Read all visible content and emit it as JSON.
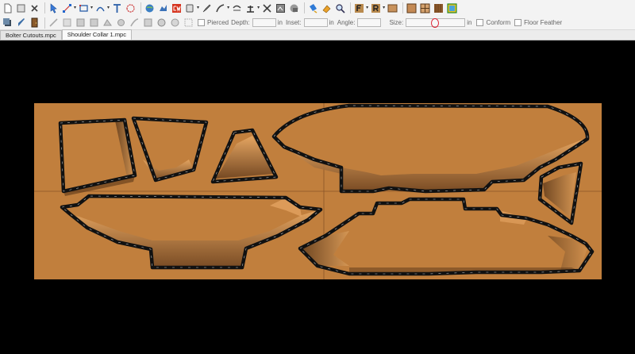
{
  "toolbar": {
    "buttons": [
      "new-file-icon",
      "open-file-icon",
      "close-icon",
      "select-arrow-icon",
      "node-edit-icon",
      "rectangle-icon",
      "arc-icon",
      "text-tool-icon",
      "spiral-icon",
      "globe-icon",
      "bitmap-icon",
      "cw-icon",
      "vector-shape-icon",
      "brush-icon",
      "sculpt-icon",
      "merge-icon",
      "symmetry-icon",
      "cross-move-icon",
      "mask-icon",
      "zoom-icon",
      "flip-f-icon",
      "rotate-r-icon",
      "render-icon",
      "material-icon",
      "wood-texture-icon",
      "lk-icon"
    ]
  },
  "options": {
    "pierced_label": "Pierced",
    "depth_label": "Depth:",
    "depth_value": "",
    "inset_label": "Inset:",
    "inset_value": "",
    "angle_label": "Angle:",
    "angle_value": "",
    "size_label": "Size:",
    "size_value": "",
    "unit": "in",
    "conform_label": "Conform",
    "floor_feather_label": "Floor Feather"
  },
  "tabs": [
    {
      "label": "Bolter Cutouts.mpc",
      "active": false
    },
    {
      "label": "Shoulder Collar 1.mpc",
      "active": true
    }
  ],
  "canvas": {
    "background_color": "#000000",
    "board_color": "#c17f3d",
    "outline_color": "#111111",
    "bevel_light": "#e7a765",
    "bevel_dark": "#5a3518"
  }
}
